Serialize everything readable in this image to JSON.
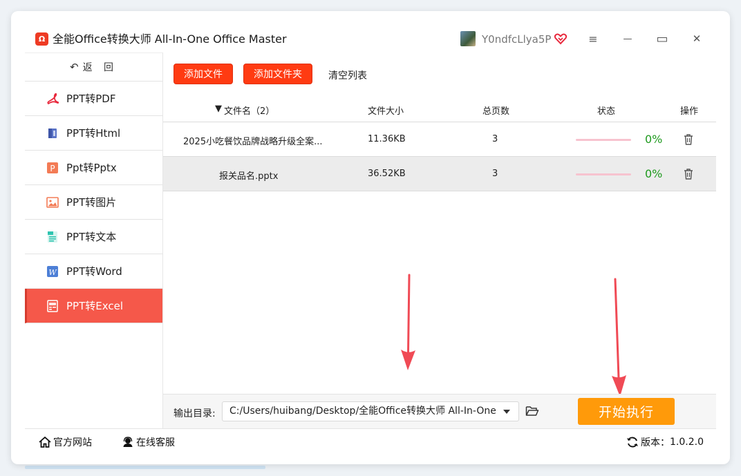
{
  "app": {
    "logo_glyph": "Ω",
    "title": "全能Office转换大师 All-In-One Office Master",
    "username": "Y0ndfcLlya5P"
  },
  "window_controls": {
    "menu": "≡",
    "minimize": "—",
    "maximize": "▭",
    "close": "✕"
  },
  "sidebar": {
    "back": "返 回",
    "items": [
      {
        "label": "PPT转PDF",
        "icon": "pdf-icon",
        "active": false
      },
      {
        "label": "PPT转Html",
        "icon": "html-icon",
        "active": false
      },
      {
        "label": "Ppt转Pptx",
        "icon": "pptx-icon",
        "active": false
      },
      {
        "label": "PPT转图片",
        "icon": "image-icon",
        "active": false
      },
      {
        "label": "PPT转文本",
        "icon": "text-icon",
        "active": false
      },
      {
        "label": "PPT转Word",
        "icon": "word-icon",
        "active": false
      },
      {
        "label": "PPT转Excel",
        "icon": "excel-icon",
        "active": true
      }
    ]
  },
  "toolbar": {
    "add_file": "添加文件",
    "add_folder": "添加文件夹",
    "clear_list": "清空列表"
  },
  "table": {
    "headers": {
      "name": "文件名（2）",
      "size": "文件大小",
      "pages": "总页数",
      "status": "状态",
      "action": "操作"
    },
    "rows": [
      {
        "name": "2025小吃餐饮品牌战略升级全案...",
        "size": "11.36KB",
        "pages": "3",
        "progress": "0%"
      },
      {
        "name": "报关品名.pptx",
        "size": "36.52KB",
        "pages": "3",
        "progress": "0%"
      }
    ]
  },
  "output": {
    "label": "输出目录:",
    "path": "C:/Users/huibang/Desktop/全能Office转换大师 All-In-One"
  },
  "start_button": "开始执行",
  "footer": {
    "website": "官方网站",
    "support": "在线客服",
    "version_label": "版本：",
    "version": "1.0.2.0"
  },
  "colors": {
    "accent_red": "#ff3b12",
    "active_nav": "#f5584a",
    "start_orange": "#ff9a0a",
    "progress_green": "#1f9a1f",
    "arrow_red": "#f04a55"
  }
}
